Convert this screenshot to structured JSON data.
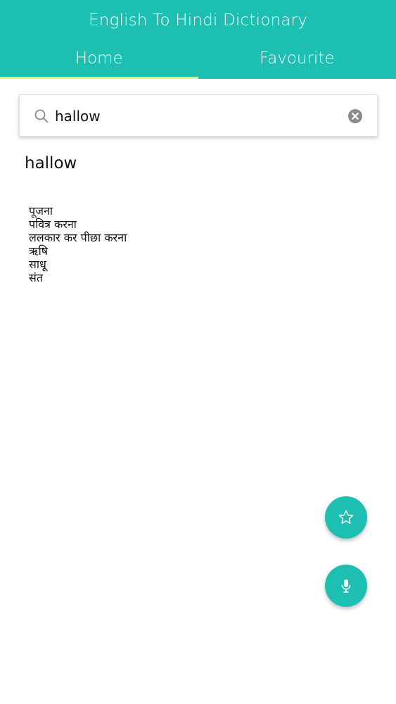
{
  "header": {
    "title": "English To Hindi Dictionary",
    "tabs": [
      {
        "label": "Home",
        "active": true
      },
      {
        "label": "Favourite",
        "active": false
      }
    ]
  },
  "search": {
    "value": "hallow",
    "placeholder": ""
  },
  "result": {
    "word": "hallow",
    "meanings": [
      "पूजना",
      "पवित्र करना",
      "ललकार कर पीछा करना",
      "ऋषि",
      "साधू",
      "संत"
    ]
  },
  "fabs": {
    "favourite_icon": "star-icon",
    "voice_icon": "microphone-icon"
  },
  "colors": {
    "primary": "#1cbfb1",
    "tab_indicator": "#e8f57a",
    "text": "#111111"
  }
}
